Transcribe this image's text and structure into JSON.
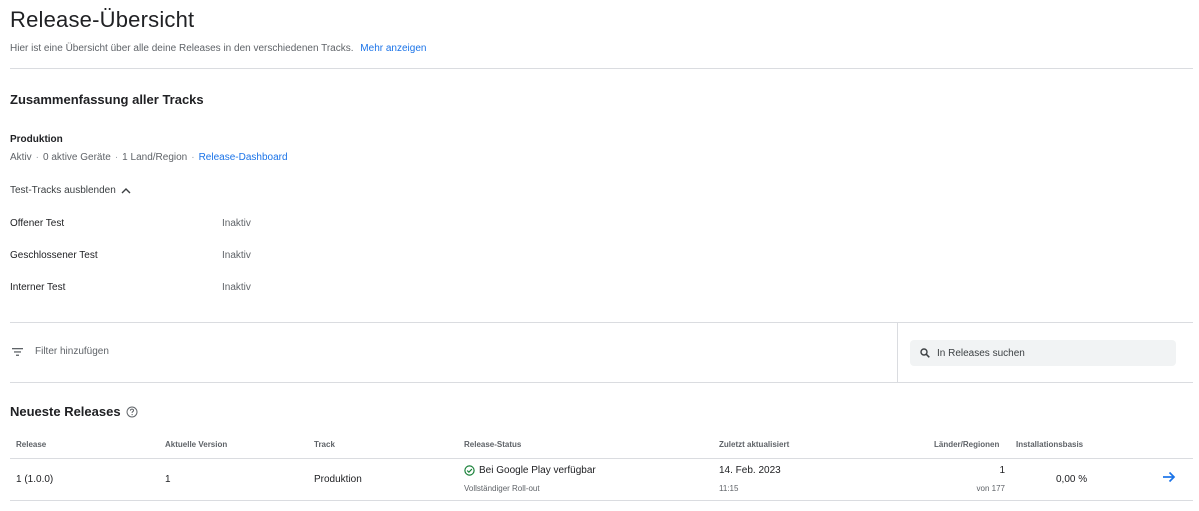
{
  "header": {
    "title": "Release-Übersicht",
    "subtitle": "Hier ist eine Übersicht über alle deine Releases in den verschiedenen Tracks.",
    "more_link": "Mehr anzeigen"
  },
  "summary": {
    "title": "Zusammenfassung aller Tracks",
    "production": {
      "label": "Produktion",
      "status": "Aktiv",
      "devices": "0 aktive Geräte",
      "regions": "1 Land/Region",
      "dashboard_link": "Release-Dashboard"
    },
    "toggle_label": "Test-Tracks ausblenden",
    "test_tracks": [
      {
        "name": "Offener Test",
        "status": "Inaktiv"
      },
      {
        "name": "Geschlossener Test",
        "status": "Inaktiv"
      },
      {
        "name": "Interner Test",
        "status": "Inaktiv"
      }
    ]
  },
  "filter": {
    "label": "Filter hinzufügen",
    "search_placeholder": "In Releases suchen"
  },
  "releases": {
    "title": "Neueste Releases",
    "columns": [
      "Release",
      "Aktuelle Version",
      "Track",
      "Release-Status",
      "Zuletzt aktualisiert",
      "Länder/Regionen",
      "Installationsbasis"
    ],
    "rows": [
      {
        "release": "1 (1.0.0)",
        "version": "1",
        "track": "Produktion",
        "status": "Bei Google Play verfügbar",
        "rollout": "Vollständiger Roll-out",
        "updated_date": "14. Feb. 2023",
        "updated_time": "11:15",
        "countries": "1",
        "countries_of": "von 177",
        "install_base": "0,00 %"
      }
    ]
  },
  "colors": {
    "link": "#1a73e8",
    "success": "#188038",
    "divider": "#dadce0"
  },
  "icons": [
    "filter-icon",
    "search-icon",
    "help-icon",
    "chevron-up-icon",
    "check-circle-icon",
    "arrow-right-icon"
  ]
}
